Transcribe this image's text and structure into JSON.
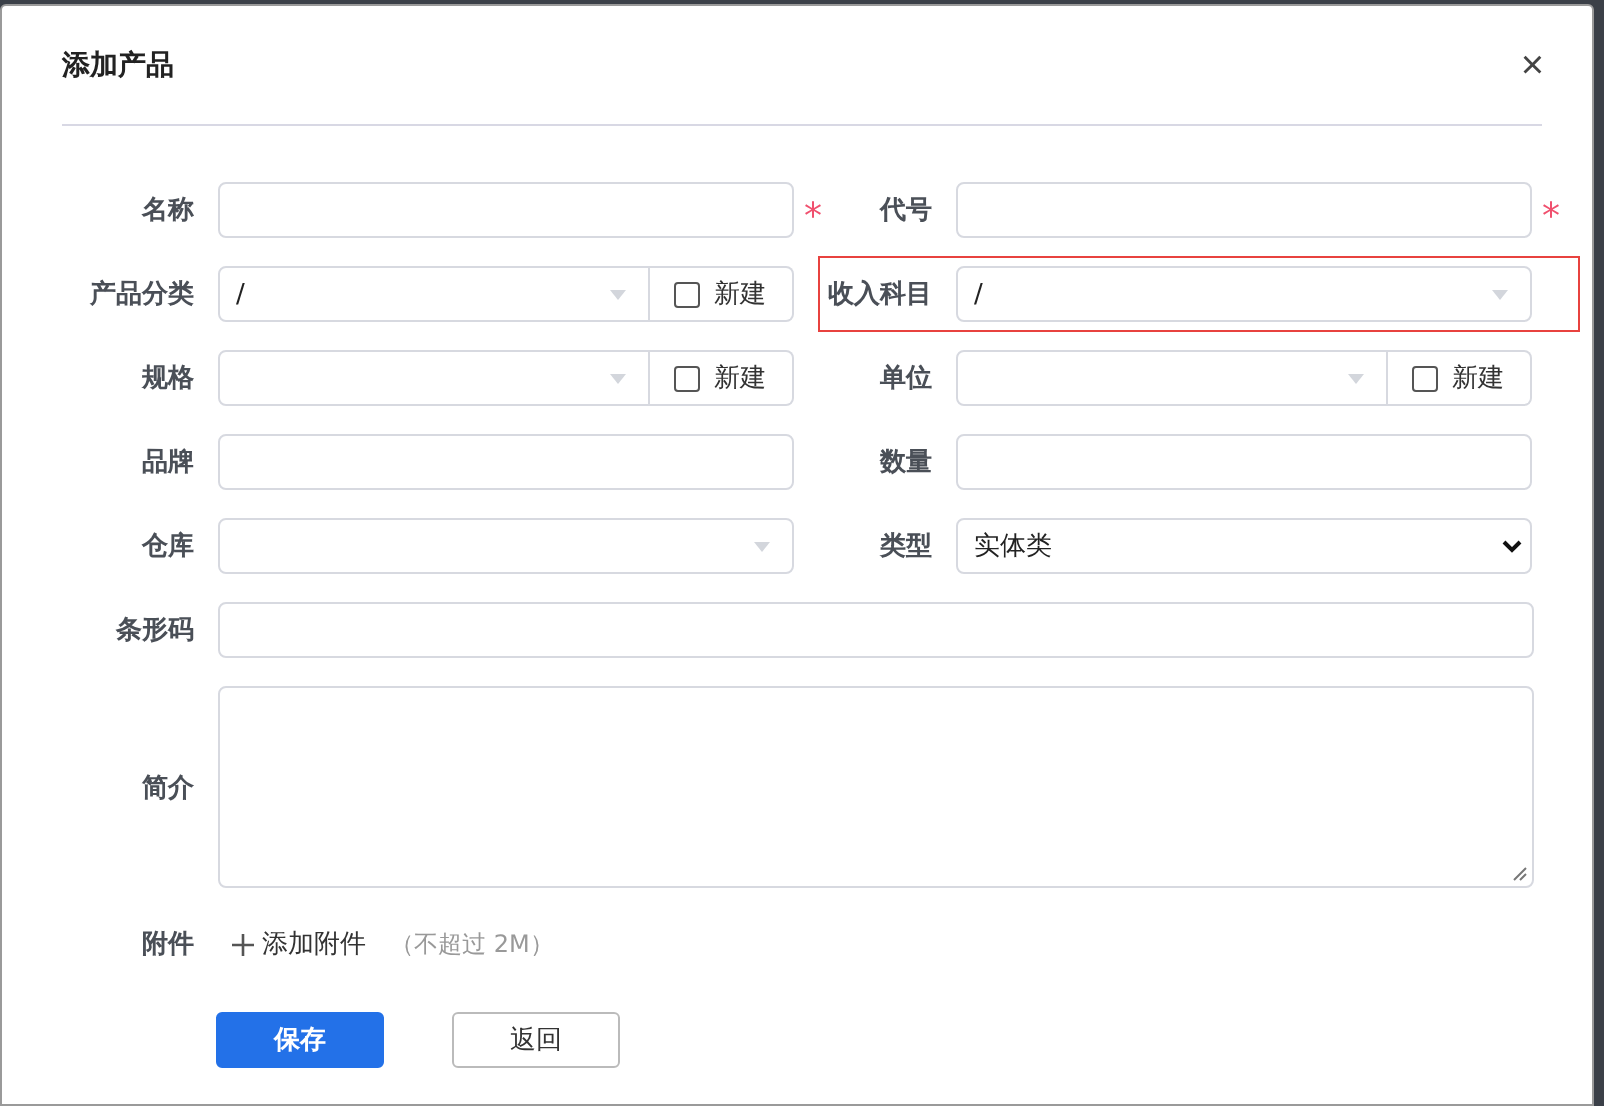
{
  "dialog": {
    "title": "添加产品",
    "close": "×"
  },
  "rows": [
    [
      {
        "label": "名称",
        "kind": "input",
        "required_mark": "*"
      },
      {
        "label": "代号",
        "kind": "input",
        "required_mark": "*"
      }
    ],
    [
      {
        "label": "产品分类",
        "kind": "select_new",
        "value": "/",
        "new_label": "新建",
        "new_checked": false
      },
      {
        "label": "收入科目",
        "kind": "select",
        "value": "/",
        "highlighted": true
      }
    ],
    [
      {
        "label": "规格",
        "kind": "select_new",
        "new_label": "新建",
        "new_checked": false
      },
      {
        "label": "单位",
        "kind": "select_new",
        "new_label": "新建",
        "new_checked": false
      }
    ],
    [
      {
        "label": "品牌",
        "kind": "input"
      },
      {
        "label": "数量",
        "kind": "input"
      }
    ],
    [
      {
        "label": "仓库",
        "kind": "select"
      },
      {
        "label": "类型",
        "kind": "dropdown",
        "value": "实体类"
      }
    ],
    [
      {
        "label": "条形码",
        "kind": "input"
      }
    ],
    [
      {
        "label": "简介",
        "kind": "textarea"
      }
    ],
    [
      {
        "label": "附件",
        "kind": "attachment",
        "add_label": "添加附件",
        "hint": "（不超过 2M）"
      }
    ]
  ],
  "buttons": [
    {
      "label": "保存",
      "kind": "primary"
    },
    {
      "label": "返回",
      "kind": "secondary"
    }
  ]
}
